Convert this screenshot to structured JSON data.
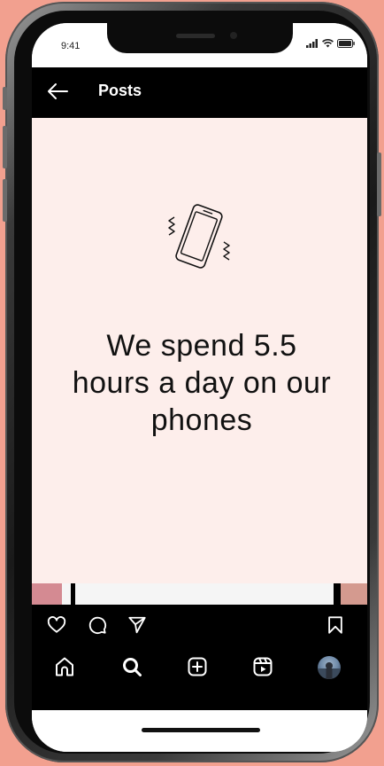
{
  "status_bar": {
    "time": "9:41"
  },
  "header": {
    "title": "Posts",
    "back_icon": "arrow-left-icon"
  },
  "post": {
    "illustration_icon": "vibrating-phone-icon",
    "text_lines": [
      "We spend 5.5",
      "hours a day on our",
      "phones"
    ]
  },
  "actions": {
    "like_icon": "heart-icon",
    "comment_icon": "comment-icon",
    "share_icon": "send-icon",
    "save_icon": "bookmark-icon"
  },
  "bottom_nav": {
    "items": [
      {
        "icon": "home-icon"
      },
      {
        "icon": "search-icon"
      },
      {
        "icon": "add-post-icon"
      },
      {
        "icon": "reels-icon"
      },
      {
        "icon": "profile-avatar"
      }
    ]
  },
  "colors": {
    "background": "#f2a08f",
    "post_background": "#fdeeeb",
    "bar": "#000000"
  }
}
